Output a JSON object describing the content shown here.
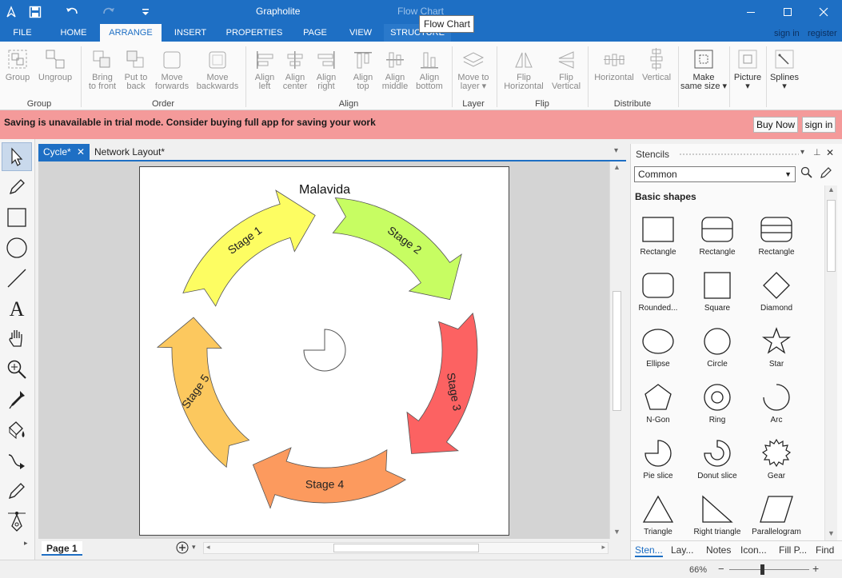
{
  "app": {
    "title": "Grapholite",
    "context_title": "Flow Chart",
    "tooltip": "Flow Chart"
  },
  "window_icons": [
    "minimize-icon",
    "maximize-icon",
    "close-icon"
  ],
  "ribbon_tabs": [
    {
      "label": "FILE",
      "active": false
    },
    {
      "label": "HOME",
      "active": false
    },
    {
      "label": "ARRANGE",
      "active": true
    },
    {
      "label": "INSERT",
      "active": false
    },
    {
      "label": "PROPERTIES",
      "active": false
    },
    {
      "label": "PAGE",
      "active": false
    },
    {
      "label": "VIEW",
      "active": false
    },
    {
      "label": "STRUCTURE",
      "active": false
    }
  ],
  "account": {
    "sign_in": "sign in",
    "register": "register"
  },
  "ribbon": {
    "groups": {
      "group": "Group",
      "order": "Order",
      "align": "Align",
      "layer": "Layer",
      "flip": "Flip",
      "distribute": "Distribute"
    },
    "buttons": {
      "group": [
        "Group"
      ],
      "ungroup": [
        "Ungroup"
      ],
      "bring_front": [
        "Bring",
        "to front"
      ],
      "put_back": [
        "Put to",
        "back"
      ],
      "move_forwards": [
        "Move",
        "forwards"
      ],
      "move_backwards": [
        "Move",
        "backwards"
      ],
      "align_left": [
        "Align",
        "left"
      ],
      "align_center": [
        "Align",
        "center"
      ],
      "align_right": [
        "Align",
        "right"
      ],
      "align_top": [
        "Align",
        "top"
      ],
      "align_middle": [
        "Align",
        "middle"
      ],
      "align_bottom": [
        "Align",
        "bottom"
      ],
      "move_layer": [
        "Move to",
        "layer ▾"
      ],
      "flip_h": [
        "Flip",
        "Horizontal"
      ],
      "flip_v": [
        "Flip",
        "Vertical"
      ],
      "dist_h": [
        "Horizontal"
      ],
      "dist_v": [
        "Vertical"
      ],
      "same_size": [
        "Make",
        "same size ▾"
      ],
      "picture": [
        "Picture",
        "▾"
      ],
      "splines": [
        "Splines",
        "▾"
      ]
    }
  },
  "trial": {
    "message": "Saving is unavailable in trial mode. Consider buying full app for saving your work",
    "buy": "Buy Now",
    "sign_in": "sign in"
  },
  "tools": [
    "pointer-icon",
    "pen-icon",
    "rectangle-tool-icon",
    "ellipse-tool-icon",
    "line-tool-icon",
    "text-tool-icon",
    "hand-icon",
    "zoom-icon",
    "eyedropper-icon",
    "paint-bucket-icon",
    "connector-icon",
    "pencil-icon",
    "spline-tool-icon"
  ],
  "documents": [
    {
      "label": "Cycle*",
      "active": true
    },
    {
      "label": "Network Layout*",
      "active": false
    }
  ],
  "diagram": {
    "title": "Malavida",
    "stages": [
      {
        "label": "Stage 1",
        "color": "#fdfd62"
      },
      {
        "label": "Stage 2",
        "color": "#c7fd62"
      },
      {
        "label": "Stage 3",
        "color": "#fc6262"
      },
      {
        "label": "Stage 4",
        "color": "#fc9a5e"
      },
      {
        "label": "Stage 5",
        "color": "#fcc85e"
      }
    ]
  },
  "page_tab": "Page 1",
  "stencils": {
    "title": "Stencils",
    "category": "Common",
    "section": "Basic shapes",
    "shapes": [
      "Rectangle",
      "Rectangle",
      "Rectangle",
      "Rounded...",
      "Square",
      "Diamond",
      "Ellipse",
      "Circle",
      "Star",
      "N-Gon",
      "Ring",
      "Arc",
      "Pie slice",
      "Donut slice",
      "Gear",
      "Triangle",
      "Right triangle",
      "Parallelogram"
    ],
    "tabs": [
      "Sten...",
      "Lay...",
      "Notes",
      "Icon...",
      "Fill P...",
      "Find"
    ]
  },
  "status": {
    "zoom": "66%"
  },
  "colors": {
    "accent": "#1e6fc4",
    "trial_bar": "#f49a9a"
  }
}
